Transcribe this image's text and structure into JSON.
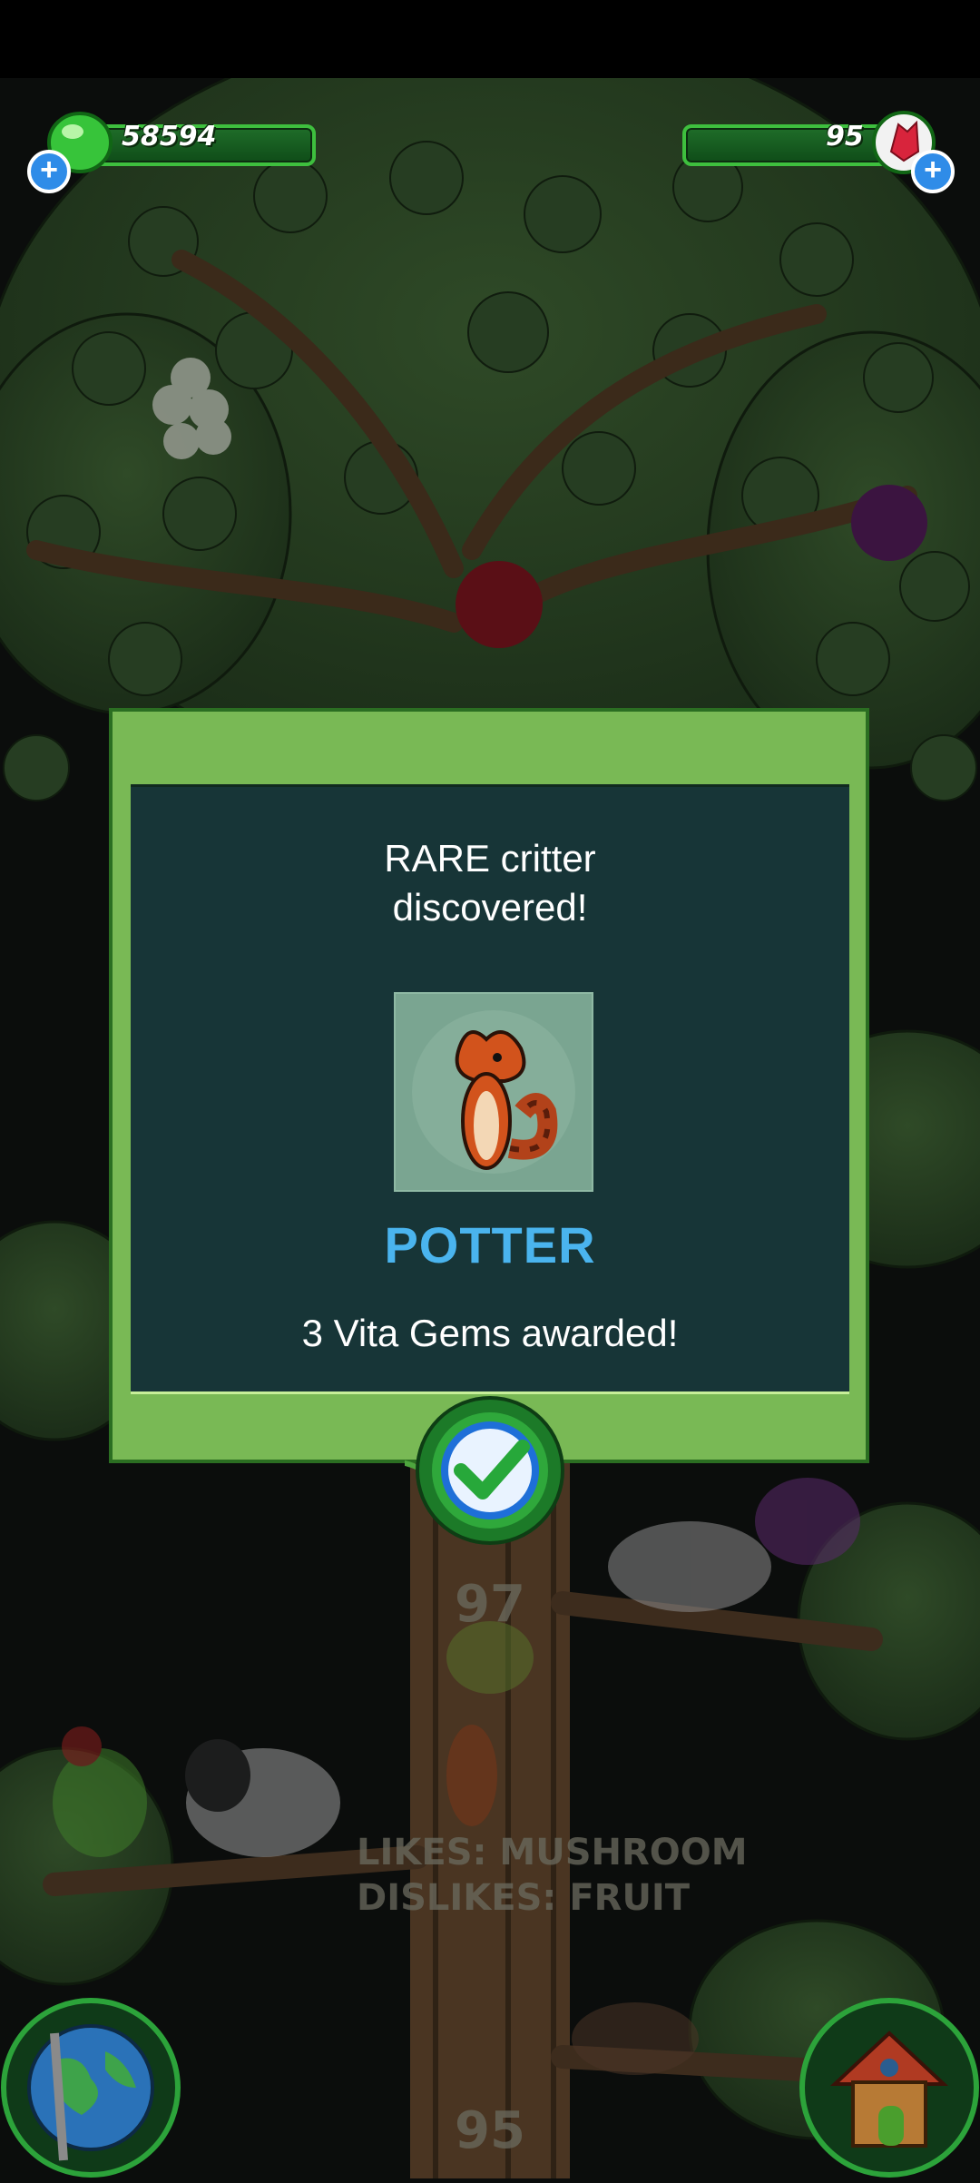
{
  "status_bar": {},
  "currency": {
    "green_gems": "58594",
    "vita_gems": "95"
  },
  "dialog": {
    "title": "RARE critter\ndiscovered!",
    "critter_name": "POTTER",
    "reward_text": "3 Vita Gems awarded!"
  },
  "tree_sign": {
    "likes": "LIKES: MUSHROOM",
    "dislikes": "DISLIKES: FRUIT",
    "level_top": "97",
    "level_bottom": "95"
  },
  "icons": {
    "confirm": "checkmark-icon",
    "world": "globe-icon",
    "home": "house-icon",
    "green_currency": "green-gem-icon",
    "red_currency": "red-crystal-icon",
    "add": "plus-icon"
  },
  "colors": {
    "dialog_frame": "#79b955",
    "dialog_panel": "#173537",
    "critter_name": "#4ab4ee",
    "currency_bar": "#1f6d29"
  }
}
